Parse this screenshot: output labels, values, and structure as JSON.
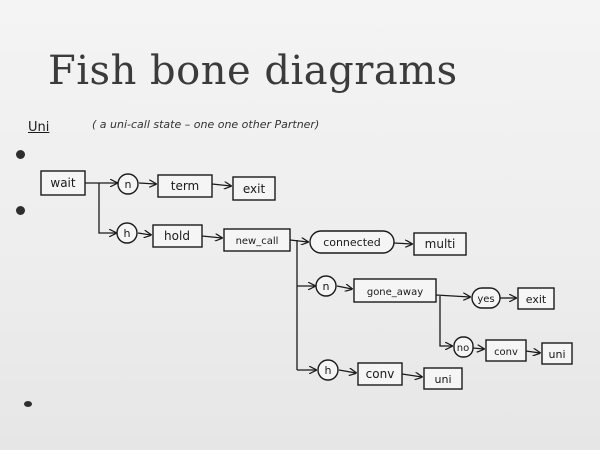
{
  "slide": {
    "title": "Fish bone diagrams",
    "subtitle": "Uni",
    "note": "( a  uni-call state – one one other Partner)"
  },
  "diagram": {
    "nodes": {
      "wait": "wait",
      "n1": "n",
      "term": "term",
      "exit1": "exit",
      "h1": "h",
      "hold": "hold",
      "new_call": "new_call",
      "connected": "connected",
      "multi": "multi",
      "n2": "n",
      "gone_away": "gone_away",
      "yes": "yes",
      "exit2": "exit",
      "no": "no",
      "conv1": "conv",
      "uni1": "uni",
      "h2": "h",
      "conv2": "conv",
      "uni2": "uni"
    }
  }
}
